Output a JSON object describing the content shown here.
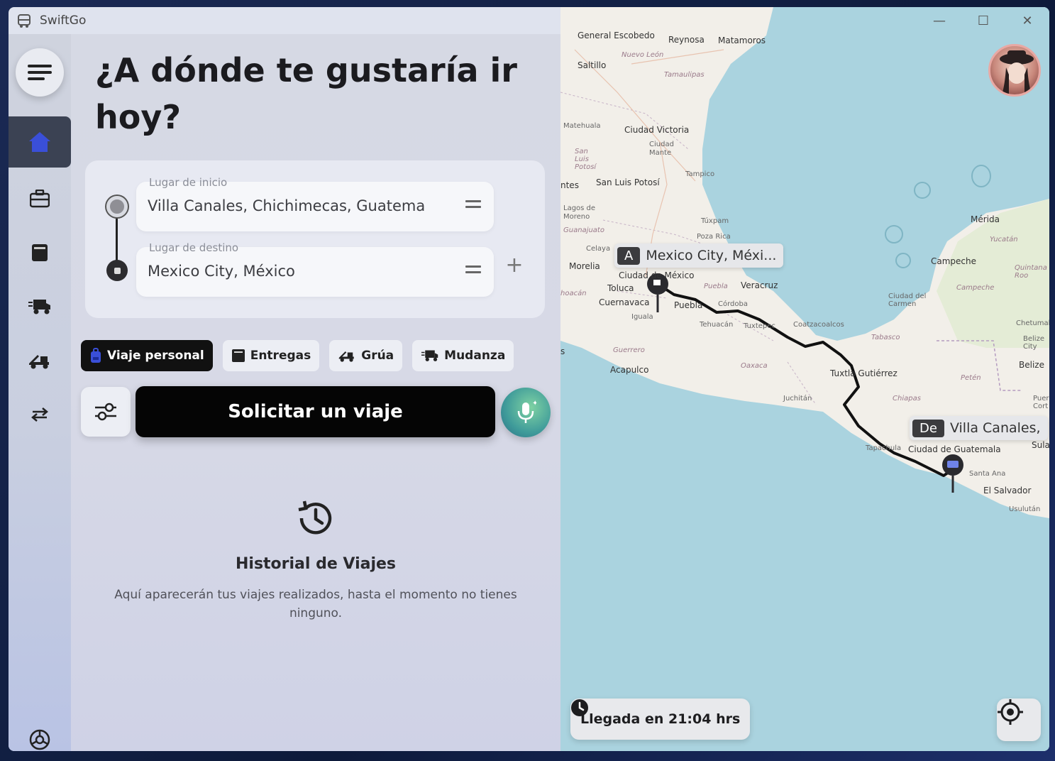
{
  "window": {
    "title": "SwiftGo"
  },
  "headline": "¿A dónde te gustaría ir hoy?",
  "route": {
    "start_label": "Lugar de inicio",
    "start_value": "Villa Canales, Chichimecas, Guatema",
    "dest_label": "Lugar de destino",
    "dest_value": "Mexico City, México"
  },
  "chips": [
    {
      "label": "Viaje personal",
      "icon": "backpack-icon",
      "active": true
    },
    {
      "label": "Entregas",
      "icon": "box-icon",
      "active": false
    },
    {
      "label": "Grúa",
      "icon": "tow-truck-icon",
      "active": false
    },
    {
      "label": "Mudanza",
      "icon": "moving-truck-icon",
      "active": false
    }
  ],
  "request_button": "Solicitar un viaje",
  "history": {
    "title": "Historial de Viajes",
    "empty_text": "Aquí aparecerán tus viajes realizados, hasta el momento no tienes ninguno."
  },
  "map": {
    "dest_tag_letter": "A",
    "dest_tag_text": "Mexico City, Méxi...",
    "origin_tag_letter": "De",
    "origin_tag_text": "Villa Canales,",
    "eta": "Llegada en 21:04 hrs",
    "cities": {
      "escobedo": "General Escobedo",
      "reynosa": "Reynosa",
      "matamoros": "Matamoros",
      "nuevoleon": "Nuevo León",
      "saltillo": "Saltillo",
      "tamaulipas": "Tamaulipas",
      "matehuala": "Matehuala",
      "victoria": "Ciudad Victoria",
      "mante": "Ciudad Mante",
      "slpstate": "San Luis Potosí",
      "tampico": "Tampico",
      "slp": "San Luis Potosí",
      "ntes": "ntes",
      "lagos": "Lagos de Moreno",
      "guanajuato": "Guanajuato",
      "tuxpam": "Túxpam",
      "pozarica": "Poza Rica",
      "celaya": "Celaya",
      "merida": "Mérida",
      "yucatan": "Yucatán",
      "morelia": "Morelia",
      "cdmx": "Ciudad de México",
      "campeche": "Campeche",
      "quintanaroo": "Quintana Roo",
      "toluca": "Toluca",
      "puebla_st": "Puebla",
      "veracruz": "Veracruz",
      "campeche_st": "Campeche",
      "michoacan": "hoacán",
      "cuernavaca": "Cuernavaca",
      "puebla": "Puebla",
      "cordoba": "Córdoba",
      "cdcarmen": "Ciudad del Carmen",
      "iguala": "Iguala",
      "tehuacan": "Tehuacán",
      "tuxtepec": "Tuxtepec",
      "coatza": "Coatzacoalcos",
      "tabasco": "Tabasco",
      "chetumal": "Chetumal",
      "belize": "Belize City",
      "belize_c": "Belize",
      "guerrero": "Guerrero",
      "oaxaca": "Oaxaca",
      "tuxtla": "Tuxtla Gutiérrez",
      "acapulco": "Acapulco",
      "peten": "Petén",
      "juchitan": "Juchitán",
      "chiapas": "Chiapas",
      "puerto": "Puer Cort",
      "tapachula": "Tapachula",
      "cdguate": "Ciudad de Guatemala",
      "sula": "Sula",
      "santaana": "Santa Ana",
      "elsalvador": "El Salvador",
      "usulutan": "Usulután",
      "ss": "s"
    }
  },
  "colors": {
    "accent_blue": "#3a4fd8",
    "route": "#111111",
    "map_water": "#aad3df",
    "map_land": "#f2efe9"
  }
}
